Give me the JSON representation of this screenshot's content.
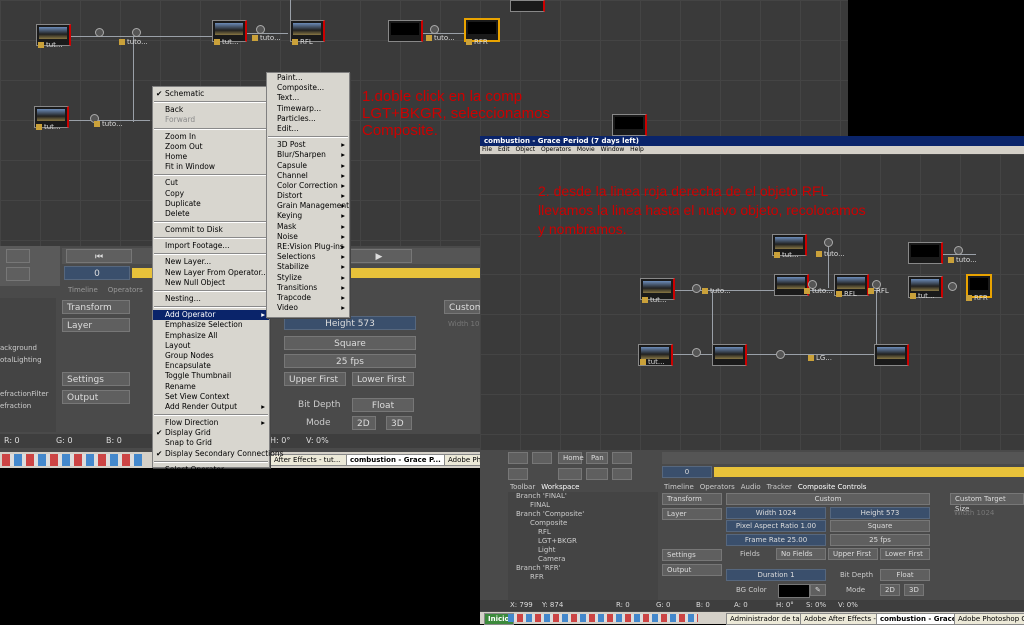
{
  "note1": {
    "line1": "1.doble click en la comp",
    "line2": "LGT+BKGR, seleccionamos",
    "line3": "Composite."
  },
  "note2": {
    "line1": "2. desde la linea roja derecha de el objeto RFL",
    "line2": "llevamos la linea hasta el nuevo objeto, recolocamos",
    "line3": "y nombramos."
  },
  "schematic_nodes": {
    "n1": "tut...",
    "n2": "tuto...",
    "n3": "tut...",
    "n4": "tuto...",
    "n5": "RFL",
    "n6": "tuto...",
    "n7": "RFR",
    "n8": "tut...",
    "n9": "tuto...",
    "n10": "LGT..."
  },
  "context_menu": {
    "items": [
      "Schematic",
      "Back",
      "Forward",
      "Zoom In",
      "Zoom Out",
      "Home",
      "Fit in Window",
      "Cut",
      "Copy",
      "Duplicate",
      "Delete",
      "Commit to Disk",
      "Import Footage...",
      "New Layer...",
      "New Layer From Operator...",
      "New Null Object",
      "Nesting...",
      "Add Operator",
      "Emphasize Selection",
      "Emphasize All",
      "Layout",
      "Group Nodes",
      "Encapsulate",
      "Toggle Thumbnail",
      "Rename",
      "Set View Context",
      "Add Render Output",
      "Flow Direction",
      "Display Grid",
      "Snap to Grid",
      "Display Secondary Connections",
      "Select Operator..."
    ]
  },
  "operator_menu": {
    "items": [
      "Paint...",
      "Composite...",
      "Text...",
      "Timewarp...",
      "Particles...",
      "Edit...",
      "3D Post",
      "Blur/Sharpen",
      "Capsule",
      "Channel",
      "Color Correction",
      "Distort",
      "Grain Management",
      "Keying",
      "Mask",
      "Noise",
      "RE:Vision Plug-ins",
      "Selections",
      "Stabilize",
      "Stylize",
      "Transitions",
      "Trapcode",
      "Video"
    ]
  },
  "left_panel": {
    "frame": "0",
    "tabs": [
      "Timeline",
      "Operators"
    ],
    "transform": "Transform",
    "layer": "Layer",
    "settings": "Settings",
    "output": "Output",
    "tree": [
      "ackground",
      "otalLighting",
      "efractionFilter",
      "efraction"
    ],
    "height": "Height 573",
    "square": "Square",
    "fps": "25 fps",
    "upper": "Upper First",
    "lower": "Lower First",
    "bitdepth": "Bit Depth",
    "float": "Float",
    "mode": "Mode",
    "2d": "2D",
    "3d": "3D",
    "custom": "Custom",
    "width": "Width 10",
    "status": {
      "r": "R: 0",
      "g": "G: 0",
      "b": "B: 0",
      "h": "H: 0°",
      "s": "S: 0%",
      "v": "V: 0%"
    }
  },
  "taskbar_left": {
    "item1": "After Effects - tut...",
    "item2": "combustion - Grace P...",
    "item3": "Adobe Ph"
  },
  "window2": {
    "title": "combustion - Grace Period (7 days left)",
    "menu": [
      "File",
      "Edit",
      "Object",
      "Operators",
      "Movie",
      "Window",
      "Help"
    ],
    "nodes": {
      "a": "tut...",
      "b": "tuto...",
      "c": "tut...",
      "d": "tuto...",
      "e": "RFL",
      "f": "RFL",
      "g": "tuto...",
      "h": "RFR",
      "i": "tut...",
      "j": "tuto...",
      "k": "LG...",
      "l": "tut..."
    },
    "toolbar": {
      "home": "Home",
      "pan": "Pan"
    },
    "frame": "0",
    "tabs_left": [
      "Toolbar",
      "Workspace"
    ],
    "tabs_right": [
      "Timeline",
      "Operators",
      "Audio",
      "Tracker",
      "Composite Controls"
    ],
    "tree": [
      "Branch 'FINAL'",
      "FINAL",
      "Branch 'Composite'",
      "Composite",
      "RFL",
      "LGT+BKGR",
      "Light",
      "Camera",
      "Branch 'RFR'",
      "RFR"
    ],
    "transform": "Transform",
    "layer": "Layer",
    "settings": "Settings",
    "output": "Output",
    "custom": "Custom",
    "width": "Width 1024",
    "height": "Height 573",
    "par": "Pixel Aspect Ratio 1.00",
    "square": "Square",
    "framerate": "Frame Rate 25.00",
    "fps": "25 fps",
    "fields": "Fields",
    "nofields": "No Fields",
    "upper": "Upper First",
    "lower": "Lower First",
    "duration": "Duration 1",
    "bitdepth": "Bit Depth",
    "float": "Float",
    "bgcolor": "BG Color",
    "mode": "Mode",
    "2d": "2D",
    "3d": "3D",
    "customsize": "Custom Target Size",
    "width2": "Width 1024",
    "status": {
      "x": "X: 799",
      "y": "Y: 874",
      "r": "R: 0",
      "g": "G: 0",
      "b": "B: 0",
      "a": "A: 0",
      "h": "H: 0°",
      "s": "S: 0%",
      "v": "V: 0%"
    },
    "taskbar": {
      "start": "Inicio",
      "t1": "Administrador de tareas ...",
      "t2": "Adobe After Effects - tut...",
      "t3": "combustion - Grace P...",
      "t4": "Adobe Photoshop CS3"
    }
  }
}
